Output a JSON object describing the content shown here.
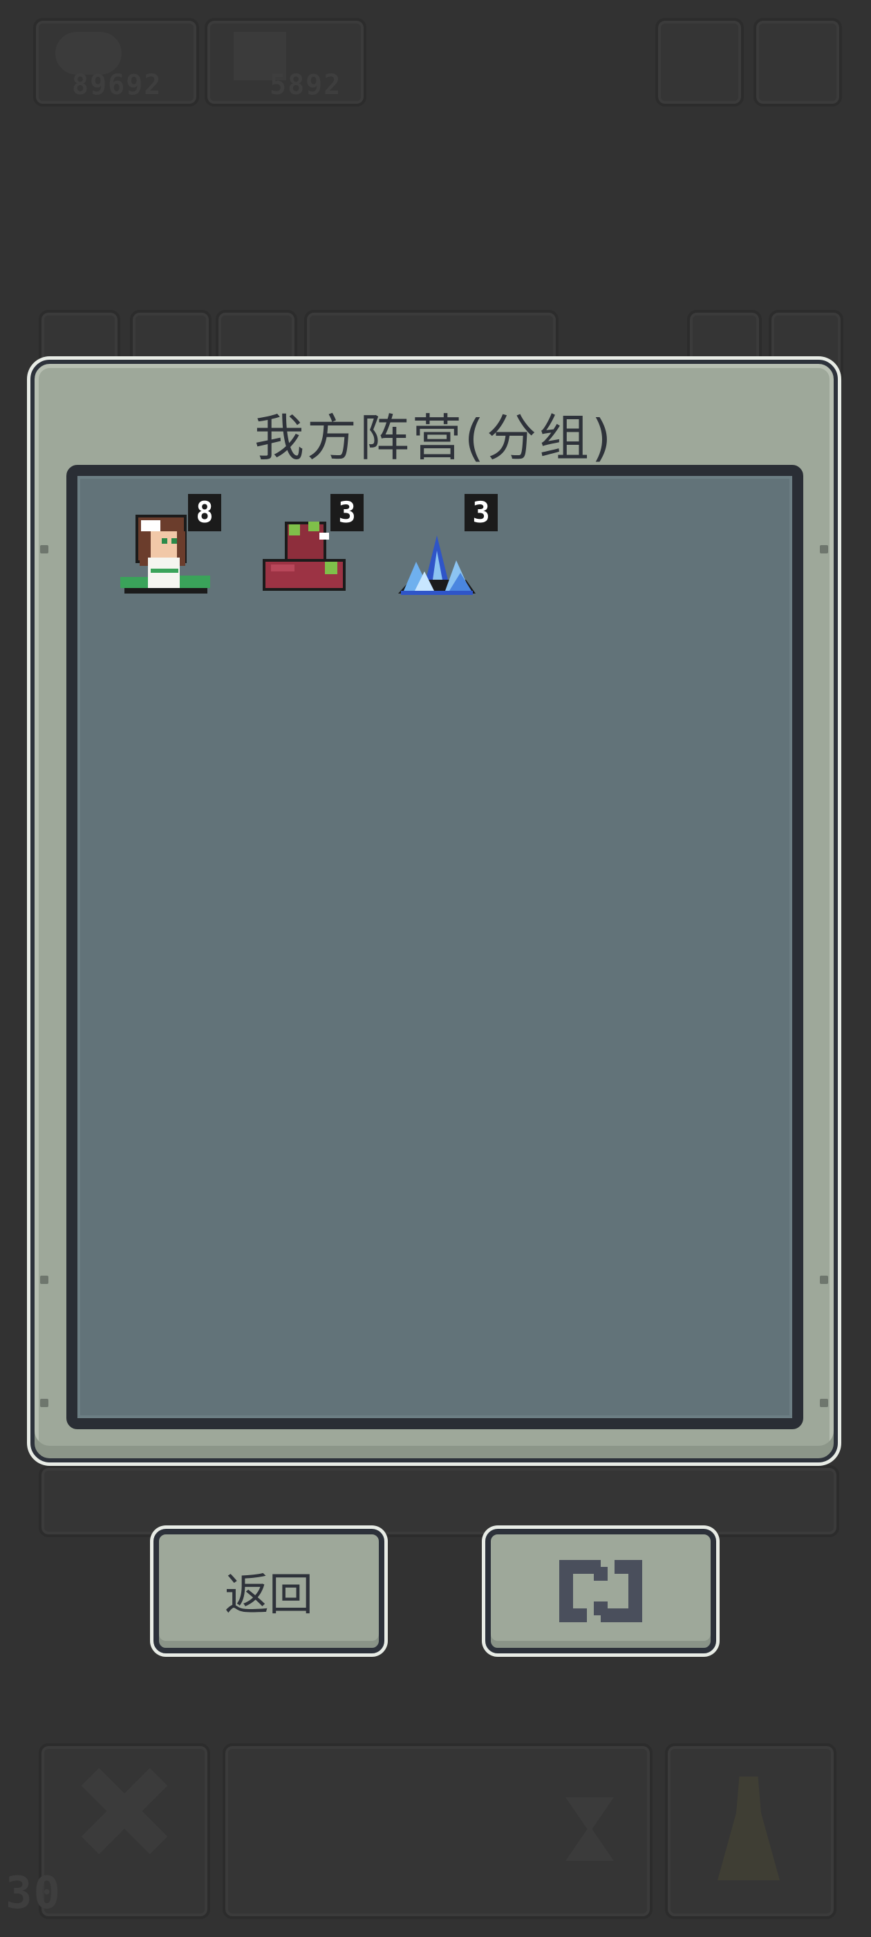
{
  "hud": {
    "resource_1": "89692",
    "resource_2": "5892",
    "bottom_counter": "30"
  },
  "panel": {
    "title": "我方阵营(分组)"
  },
  "units": [
    {
      "name": "green-haired-girl",
      "count": "8"
    },
    {
      "name": "red-slime-blob",
      "count": "3"
    },
    {
      "name": "ice-crystal",
      "count": "3"
    }
  ],
  "buttons": {
    "back_label": "返回",
    "refresh_icon": "refresh-icon"
  },
  "colors": {
    "background": "#323232",
    "panel": "#9ea89a",
    "inner": "#627379",
    "frame": "#2a2e35"
  }
}
